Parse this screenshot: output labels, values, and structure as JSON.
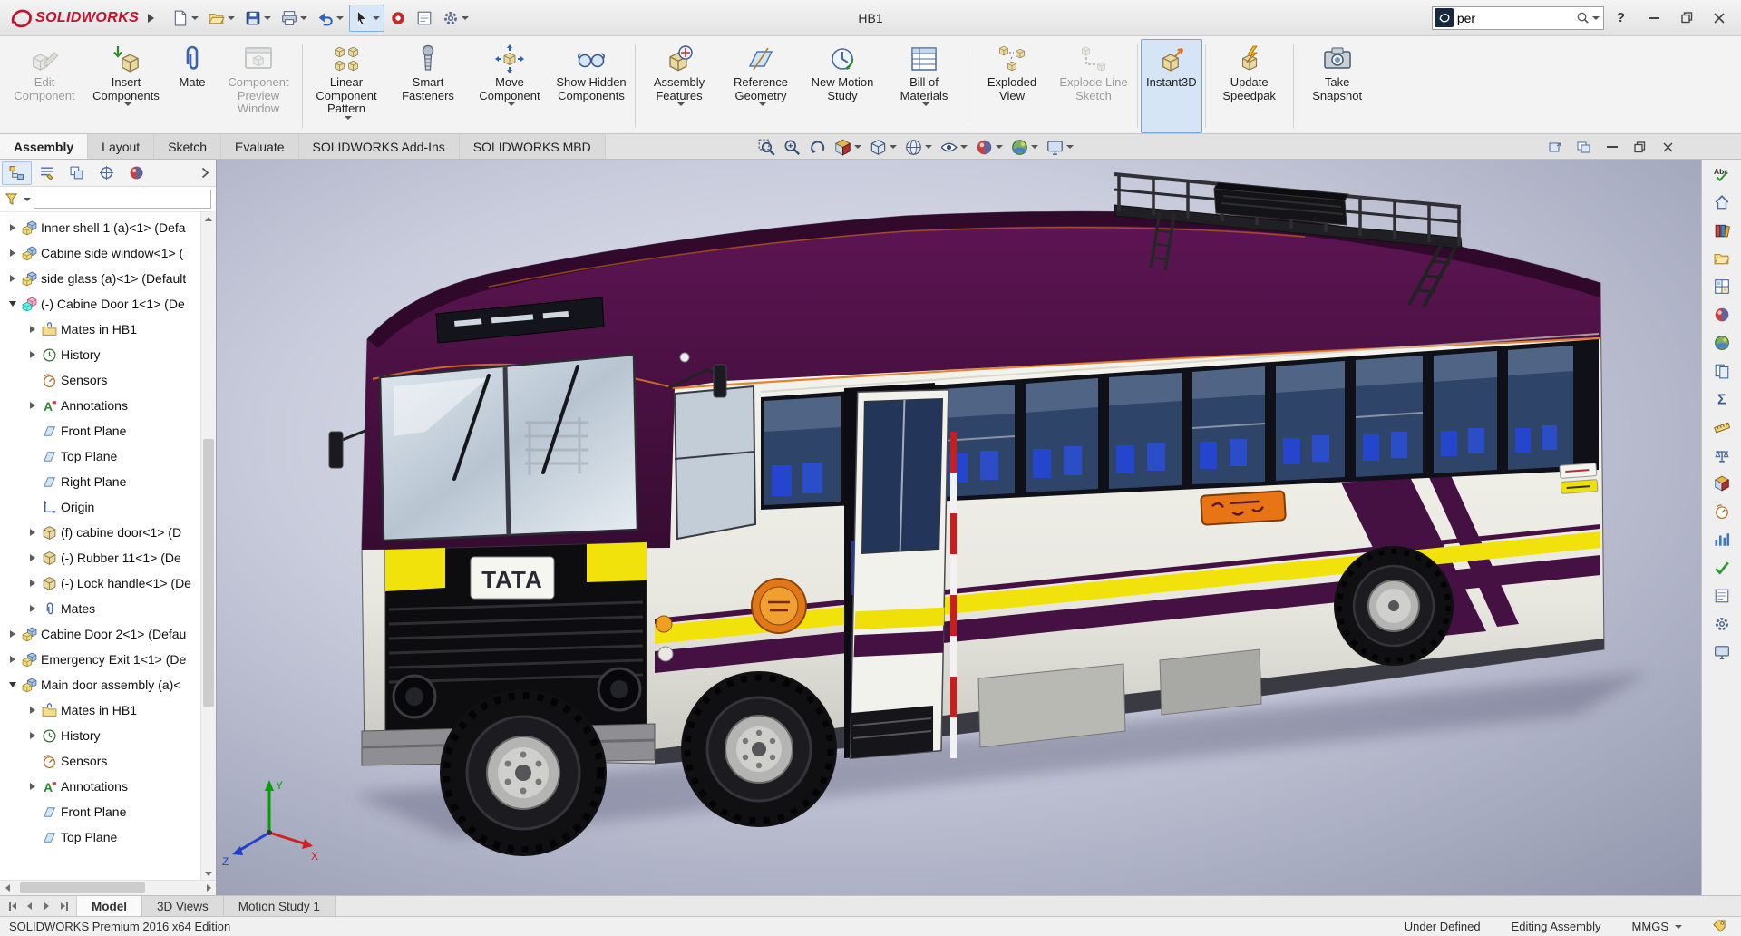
{
  "titlebar": {
    "logo_text": "SOLIDWORKS",
    "title": "HB1",
    "search_value": "per",
    "help_label": "?",
    "tools": [
      "new-document",
      "open-document",
      "save",
      "print",
      "undo",
      "select-tool",
      "xpress-products",
      "design-journal",
      "options"
    ]
  },
  "ribbon": {
    "buttons": [
      {
        "label": "Edit Component",
        "state": "disabled"
      },
      {
        "label": "Insert Components",
        "state": "normal"
      },
      {
        "label": "Mate",
        "state": "normal"
      },
      {
        "label": "Component Preview Window",
        "state": "disabled"
      },
      {
        "label": "Linear Component Pattern",
        "state": "normal"
      },
      {
        "label": "Smart Fasteners",
        "state": "normal"
      },
      {
        "label": "Move Component",
        "state": "normal"
      },
      {
        "label": "Show Hidden Components",
        "state": "normal"
      },
      {
        "label": "Assembly Features",
        "state": "normal"
      },
      {
        "label": "Reference Geometry",
        "state": "normal"
      },
      {
        "label": "New Motion Study",
        "state": "normal"
      },
      {
        "label": "Bill of Materials",
        "state": "normal"
      },
      {
        "label": "Exploded View",
        "state": "normal"
      },
      {
        "label": "Explode Line Sketch",
        "state": "disabled"
      },
      {
        "label": "Instant3D",
        "state": "active"
      },
      {
        "label": "Update Speedpak",
        "state": "normal"
      },
      {
        "label": "Take Snapshot",
        "state": "normal"
      }
    ]
  },
  "tabs": [
    "Assembly",
    "Layout",
    "Sketch",
    "Evaluate",
    "SOLIDWORKS Add-Ins",
    "SOLIDWORKS MBD"
  ],
  "headsup_icons": [
    "zoom-to-fit",
    "zoom-to-area",
    "previous-view",
    "section-view",
    "view-orientation",
    "display-style",
    "hide-show-items",
    "edit-appearance",
    "apply-scene",
    "view-settings"
  ],
  "tree": {
    "items": [
      {
        "label": "Inner shell 1 (a)<1> (Defa",
        "icon": "assembly"
      },
      {
        "label": "Cabine side window<1> (",
        "icon": "assembly"
      },
      {
        "label": "side glass (a)<1> (Default",
        "icon": "assembly"
      },
      {
        "label": "(-) Cabine Door 1<1> (De",
        "icon": "assembly-active"
      },
      {
        "label": "Mates in HB1",
        "icon": "mates-folder"
      },
      {
        "label": "History",
        "icon": "history-folder"
      },
      {
        "label": "Sensors",
        "icon": "sensors-folder"
      },
      {
        "label": "Annotations",
        "icon": "annotations-folder"
      },
      {
        "label": "Front Plane",
        "icon": "plane"
      },
      {
        "label": "Top Plane",
        "icon": "plane"
      },
      {
        "label": "Right Plane",
        "icon": "plane"
      },
      {
        "label": "Origin",
        "icon": "origin"
      },
      {
        "label": "(f) cabine door<1> (D",
        "icon": "part"
      },
      {
        "label": "(-) Rubber 11<1> (De",
        "icon": "part"
      },
      {
        "label": "(-) Lock handle<1> (De",
        "icon": "part"
      },
      {
        "label": "Mates",
        "icon": "mates-folder"
      },
      {
        "label": "Cabine Door 2<1> (Defau",
        "icon": "assembly"
      },
      {
        "label": "Emergency Exit 1<1> (De",
        "icon": "assembly"
      },
      {
        "label": "Main door assembly (a)<",
        "icon": "assembly"
      },
      {
        "label": "Mates in HB1",
        "icon": "mates-folder"
      },
      {
        "label": "History",
        "icon": "history-folder"
      },
      {
        "label": "Sensors",
        "icon": "sensors-folder"
      },
      {
        "label": "Annotations",
        "icon": "annotations-folder"
      },
      {
        "label": "Front Plane",
        "icon": "plane"
      },
      {
        "label": "Top Plane",
        "icon": "plane"
      }
    ]
  },
  "viewport": {
    "badge": "TATA",
    "triad": {
      "x": "X",
      "y": "Y",
      "z": "Z"
    }
  },
  "taskpane_icons": [
    "spell-check",
    "home-resources",
    "design-library",
    "file-explorer",
    "view-palette",
    "appearances",
    "scenes",
    "custom-properties",
    "equations",
    "measure",
    "mass-properties",
    "section-properties",
    "sensors",
    "statistics",
    "check",
    "design-journal",
    "settings",
    "screen-capture"
  ],
  "bottom_tabs": [
    "Model",
    "3D Views",
    "Motion Study 1"
  ],
  "statusbar": {
    "edition": "SOLIDWORKS Premium 2016 x64 Edition",
    "constraint_status": "Under Defined",
    "mode": "Editing Assembly",
    "units": "MMGS"
  }
}
